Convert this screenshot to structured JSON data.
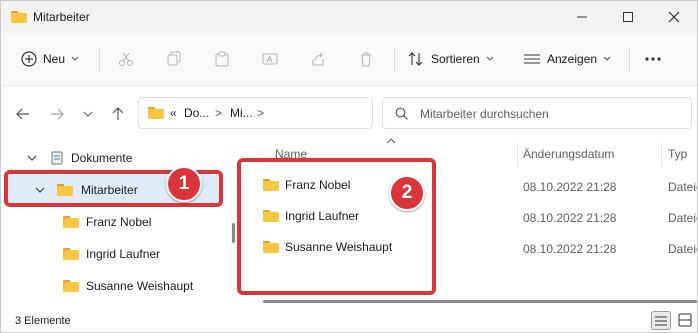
{
  "window": {
    "title": "Mitarbeiter",
    "controls": {
      "minimize_icon": "minimize-icon",
      "maximize_icon": "maximize-icon",
      "close_icon": "close-icon"
    }
  },
  "toolbar": {
    "new_label": "Neu",
    "sort_label": "Sortieren",
    "view_label": "Anzeigen",
    "more_icon": "more-icon",
    "icons": [
      "cut-icon",
      "copy-icon",
      "paste-icon",
      "rename-icon",
      "share-icon",
      "delete-icon"
    ]
  },
  "address_bar": {
    "overflow": "«",
    "crumb1": "Do...",
    "sep": ">",
    "crumb2": "Mi...",
    "sep2": ">"
  },
  "search": {
    "placeholder": "Mitarbeiter durchsuchen"
  },
  "sidebar": {
    "items": [
      {
        "label": "Dokumente"
      },
      {
        "label": "Mitarbeiter"
      },
      {
        "label": "Franz Nobel"
      },
      {
        "label": "Ingrid Laufner"
      },
      {
        "label": "Susanne Weishaupt"
      }
    ]
  },
  "columns": {
    "name": "Name",
    "date": "Änderungsdatum",
    "type": "Typ"
  },
  "files": [
    {
      "name": "Franz Nobel",
      "date": "08.10.2022 21:28",
      "type": "Dateio"
    },
    {
      "name": "Ingrid Laufner",
      "date": "08.10.2022 21:28",
      "type": "Dateio"
    },
    {
      "name": "Susanne Weishaupt",
      "date": "08.10.2022 21:28",
      "type": "Dateio"
    }
  ],
  "status": {
    "count": "3 Elemente"
  },
  "annotations": {
    "badge1": "1",
    "badge2": "2",
    "color": "#d9353a"
  }
}
